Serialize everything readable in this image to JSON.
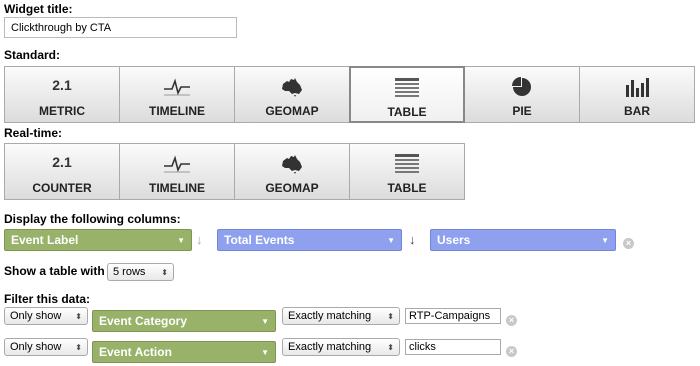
{
  "widget_title": {
    "label": "Widget title:",
    "value": "Clickthrough by CTA"
  },
  "standard": {
    "label": "Standard:",
    "buttons": [
      {
        "num": "2.1",
        "label": "METRIC"
      },
      {
        "label": "TIMELINE",
        "icon": "timeline-icon"
      },
      {
        "label": "GEOMAP",
        "icon": "australia-map-icon"
      },
      {
        "label": "TABLE",
        "icon": "table-icon"
      },
      {
        "label": "PIE",
        "icon": "pie-icon"
      },
      {
        "label": "BAR",
        "icon": "bar-chart-icon"
      }
    ],
    "selected": "TABLE"
  },
  "realtime": {
    "label": "Real-time:",
    "buttons": [
      {
        "num": "2.1",
        "label": "COUNTER"
      },
      {
        "label": "TIMELINE",
        "icon": "timeline-icon"
      },
      {
        "label": "GEOMAP",
        "icon": "australia-map-icon"
      },
      {
        "label": "TABLE",
        "icon": "table-icon"
      }
    ]
  },
  "columns": {
    "label": "Display the following columns:",
    "items": [
      "Event Label",
      "Total Events",
      "Users"
    ]
  },
  "rows": {
    "label": "Show a table with",
    "value": "5 rows"
  },
  "filter": {
    "label": "Filter this data:",
    "rows": [
      {
        "mode": "Only show",
        "dimension": "Event Category",
        "match": "Exactly matching",
        "value": "RTP-Campaigns"
      },
      {
        "mode": "Only show",
        "dimension": "Event Action",
        "match": "Exactly matching",
        "value": "clicks"
      }
    ]
  },
  "colors": {
    "green_pill": "#98b26a",
    "blue_pill": "#8ea0ee"
  }
}
